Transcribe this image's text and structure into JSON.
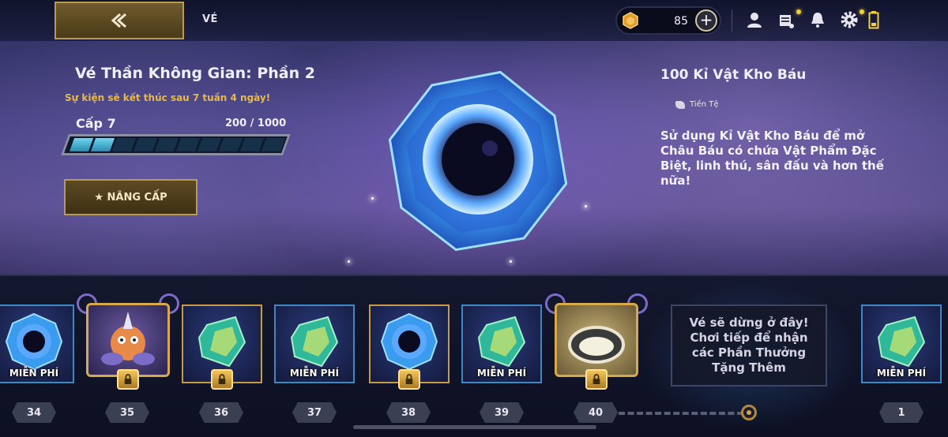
{
  "header": {
    "crumb": "VÉ",
    "currency_amount": "85"
  },
  "pass": {
    "title": "Vé Thần Không Gian: Phần 2",
    "subtitle": "Sự kiện sẽ kết thúc sau 7 tuần 4 ngày!",
    "level": "Cấp 7",
    "xp_text": "200 / 1000",
    "xp_progress": 0.2,
    "upgrade_label": "★ NÂNG CẤP"
  },
  "item": {
    "title": "100 Kỉ Vật Kho Báu",
    "type": "Tiền Tệ",
    "description": "Sử dụng Kỉ Vật Kho Báu để mở Châu Báu có chứa Vật Phẩm Đặc Biệt, linh thú, sân đấu và hơn thế nữa!"
  },
  "track": {
    "free_label": "MIỄN PHÍ",
    "stop_message": "Vé sẽ dừng ở đây! Chơi tiếp để nhận các Phần Thưởng Tặng Thêm",
    "levels": [
      "34",
      "35",
      "36",
      "37",
      "38",
      "39",
      "40",
      "1"
    ]
  },
  "colors": {
    "gold": "#b99a52",
    "accent_blue": "#3e88c8",
    "warning_text": "#e8b94a"
  }
}
